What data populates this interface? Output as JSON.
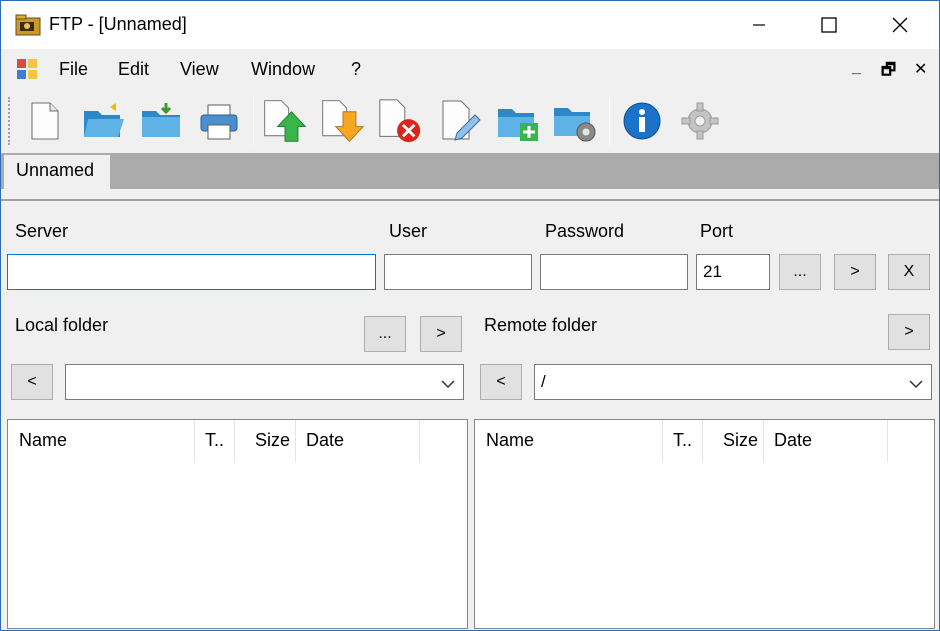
{
  "window": {
    "title": "FTP - [Unnamed]"
  },
  "menu": {
    "items": [
      "File",
      "Edit",
      "View",
      "Window",
      "?"
    ],
    "mdi_controls": [
      "_",
      "🗗",
      "✕"
    ]
  },
  "toolbar": {
    "buttons": [
      "new-document-icon",
      "open-folder-icon",
      "save-icon",
      "print-icon",
      "upload-icon",
      "download-icon",
      "delete-icon",
      "rename-icon",
      "new-folder-icon",
      "folder-settings-icon",
      "info-icon",
      "settings-gear-icon"
    ]
  },
  "tabs": [
    {
      "label": "Unnamed"
    }
  ],
  "connection": {
    "server_label": "Server",
    "server_value": "",
    "user_label": "User",
    "user_value": "",
    "password_label": "Password",
    "password_value": "",
    "port_label": "Port",
    "port_value": "21",
    "browse_label": "...",
    "connect_label": ">",
    "disconnect_label": "X"
  },
  "local": {
    "label": "Local folder",
    "browse_label": "...",
    "go_label": ">",
    "back_label": "<",
    "path": "",
    "columns": [
      "Name",
      "T..",
      "Size",
      "Date"
    ]
  },
  "remote": {
    "label": "Remote folder",
    "go_label": ">",
    "back_label": "<",
    "path": "/",
    "columns": [
      "Name",
      "T..",
      "Size",
      "Date"
    ]
  },
  "colors": {
    "accent": "#0078d7",
    "tabstrip": "#ababab",
    "chrome": "#f0f0f0"
  }
}
